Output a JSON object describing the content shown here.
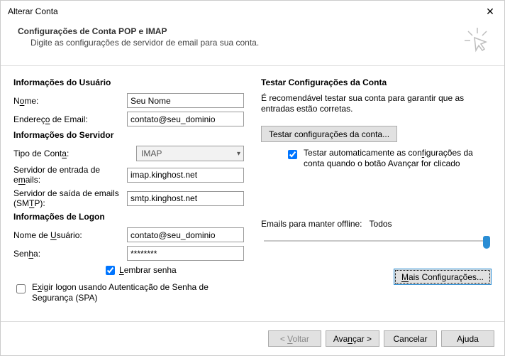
{
  "window": {
    "title": "Alterar Conta",
    "close_label": "✕"
  },
  "header": {
    "title": "Configurações de Conta POP e IMAP",
    "subtitle": "Digite as configurações de servidor de email para sua conta."
  },
  "left": {
    "section_user": "Informações do Usuário",
    "name_label_pre": "N",
    "name_label_u": "o",
    "name_label_post": "me:",
    "name_value": "Seu Nome",
    "email_label_pre": "Endereç",
    "email_label_u": "o",
    "email_label_post": " de Email:",
    "email_value": "contato@seu_dominio",
    "section_server": "Informações do Servidor",
    "type_label_pre": "Tipo de Cont",
    "type_label_u": "a",
    "type_label_post": ":",
    "type_value": "IMAP",
    "incoming_label_pre": "Servidor de entrada de e",
    "incoming_label_u": "m",
    "incoming_label_post": "ails:",
    "incoming_value": "imap.kinghost.net",
    "outgoing_label_pre": "Servidor de saída de emails (SM",
    "outgoing_label_u": "T",
    "outgoing_label_post": "P):",
    "outgoing_value": "smtp.kinghost.net",
    "section_logon": "Informações de Logon",
    "user_label_pre": "Nome de ",
    "user_label_u": "U",
    "user_label_post": "suário:",
    "user_value": "contato@seu_dominio",
    "pass_label_pre": "Sen",
    "pass_label_u": "h",
    "pass_label_post": "a:",
    "pass_value": "********",
    "remember_label_pre": "",
    "remember_label_u": "L",
    "remember_label_post": "embrar senha",
    "spa_label_pre": "E",
    "spa_label_u": "x",
    "spa_label_post": "igir logon usando Autenticação de Senha de Segurança (SPA)"
  },
  "right": {
    "section_test": "Testar Configurações da Conta",
    "desc": "É recomendável testar sua conta para garantir que as entradas estão corretas.",
    "test_button": "Testar configurações da conta...",
    "auto_test_pre": "Testar automaticamente as con",
    "auto_test_u": "f",
    "auto_test_post": "igurações da conta quando o botão Avançar for clicado",
    "offline_label": "Emails para manter offline:",
    "offline_value": "Todos",
    "more_button_pre": "",
    "more_button_u": "M",
    "more_button_post": "ais Configurações..."
  },
  "footer": {
    "back_pre": "< ",
    "back_u": "V",
    "back_post": "oltar",
    "next_pre": "Ava",
    "next_u": "n",
    "next_post": "çar >",
    "cancel": "Cancelar",
    "help": "Ajuda"
  }
}
